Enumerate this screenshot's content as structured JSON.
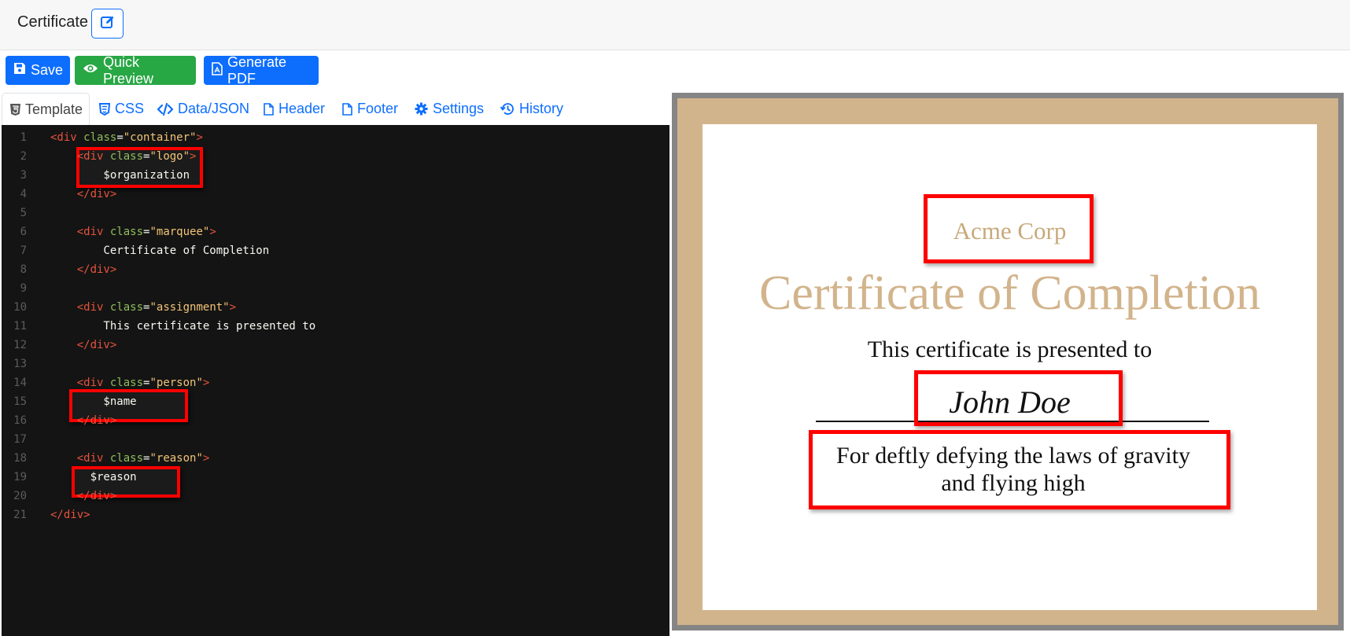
{
  "header": {
    "title": "Certificate",
    "edit_icon": "pencil-square-icon"
  },
  "toolbar": {
    "save_label": "Save",
    "preview_label": "Quick Preview",
    "pdf_label": "Generate PDF"
  },
  "tabs": [
    {
      "label": "Template",
      "icon": "html5-icon",
      "active": true
    },
    {
      "label": "CSS",
      "icon": "css3-icon"
    },
    {
      "label": "Data/JSON",
      "icon": "code-icon"
    },
    {
      "label": "Header",
      "icon": "file-icon"
    },
    {
      "label": "Footer",
      "icon": "file-icon"
    },
    {
      "label": "Settings",
      "icon": "gear-icon"
    },
    {
      "label": "History",
      "icon": "history-icon"
    }
  ],
  "editor": {
    "line_numbers": [
      "1",
      "2",
      "3",
      "4",
      "5",
      "6",
      "7",
      "8",
      "9",
      "10",
      "11",
      "12",
      "13",
      "14",
      "15",
      "16",
      "17",
      "18",
      "19",
      "20",
      "21"
    ],
    "highlight_color": "#ff0000"
  },
  "certificate": {
    "organization": "Acme Corp",
    "marquee": "Certificate of Completion",
    "assignment": "This certificate is presented to",
    "person": "John Doe",
    "reason": "For deftly defying the laws of gravity and flying high",
    "border_color": "#d2b48c"
  }
}
